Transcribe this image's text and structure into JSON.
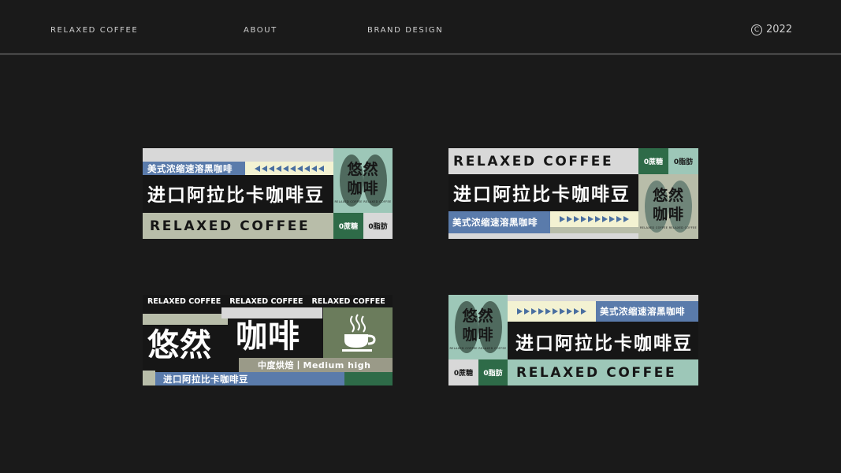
{
  "nav": {
    "brand": "RELAXED COFFEE",
    "about": "ABOUT",
    "brand_design": "BRAND DESIGN",
    "year": "2022",
    "copyright_symbol": "C"
  },
  "labels": {
    "product_cn": "进口阿拉比卡咖啡豆",
    "instant_cn": "美式浓缩速溶黑咖啡",
    "brand_en": "RELAXED COFFEE",
    "zero_sugar": "0蔗糖",
    "zero_fat": "0脂肪",
    "logo_line1": "悠然",
    "logo_line2": "咖啡",
    "logo_sub": "RELAXED COFFEE  RELAXED COFFEE",
    "big_you_ran": "悠然",
    "big_ka_fei": "咖啡",
    "roast": "中度烘焙丨Medium high"
  },
  "colors": {
    "bg": "#1a1a1a",
    "mint": "#9dc7b8",
    "dark_green": "#2e6b48",
    "sage": "#b8bda9",
    "blue": "#5a7bab",
    "cream": "#f3f2d2",
    "olive": "#6b7c5c",
    "light_gray": "#d8d8d8"
  },
  "icons": [
    "copyright-icon",
    "coffee-cup-icon",
    "triangle-arrow-icon"
  ]
}
